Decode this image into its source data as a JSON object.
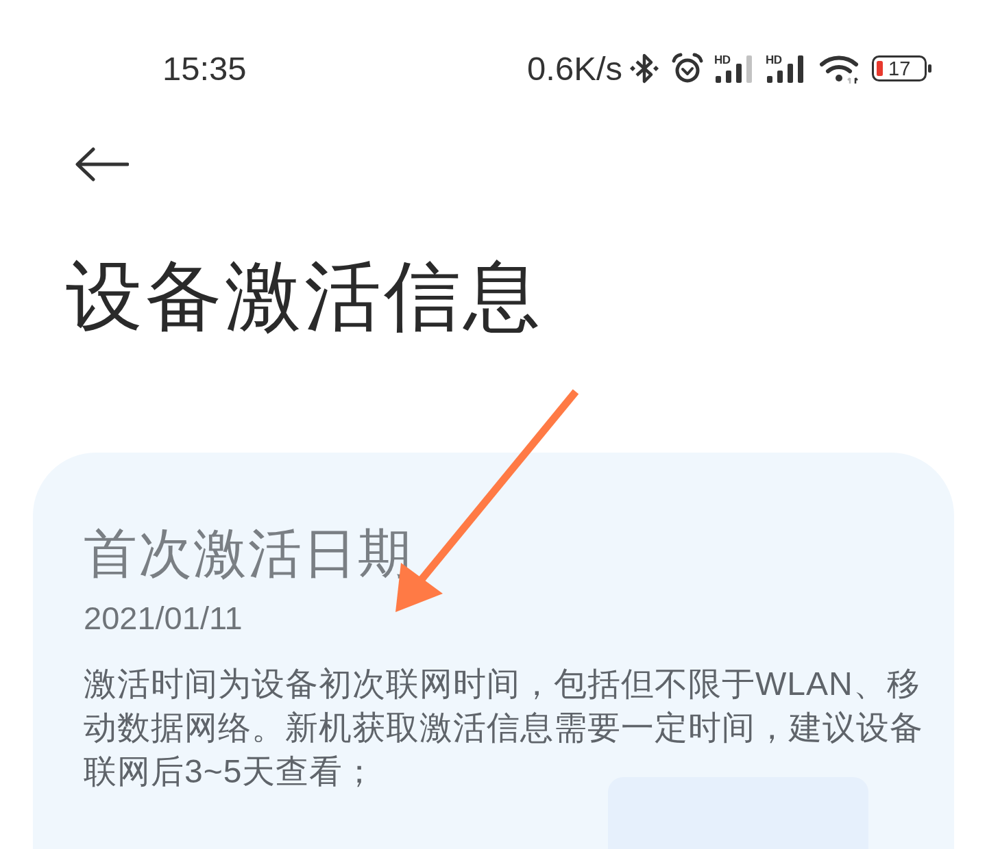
{
  "status_bar": {
    "time": "15:35",
    "net_speed": "0.6K/s",
    "signals": [
      {
        "label": "HD",
        "full": false
      },
      {
        "label": "HD",
        "full": true
      }
    ],
    "battery": "17"
  },
  "header": {
    "title": "设备激活信息"
  },
  "card": {
    "heading": "首次激活日期",
    "date": "2021/01/11",
    "description": "激活时间为设备初次联网时间，包括但不限于WLAN、移动数据网络。新机获取激活信息需要一定时间，建议设备联网后3~5天查看；"
  }
}
